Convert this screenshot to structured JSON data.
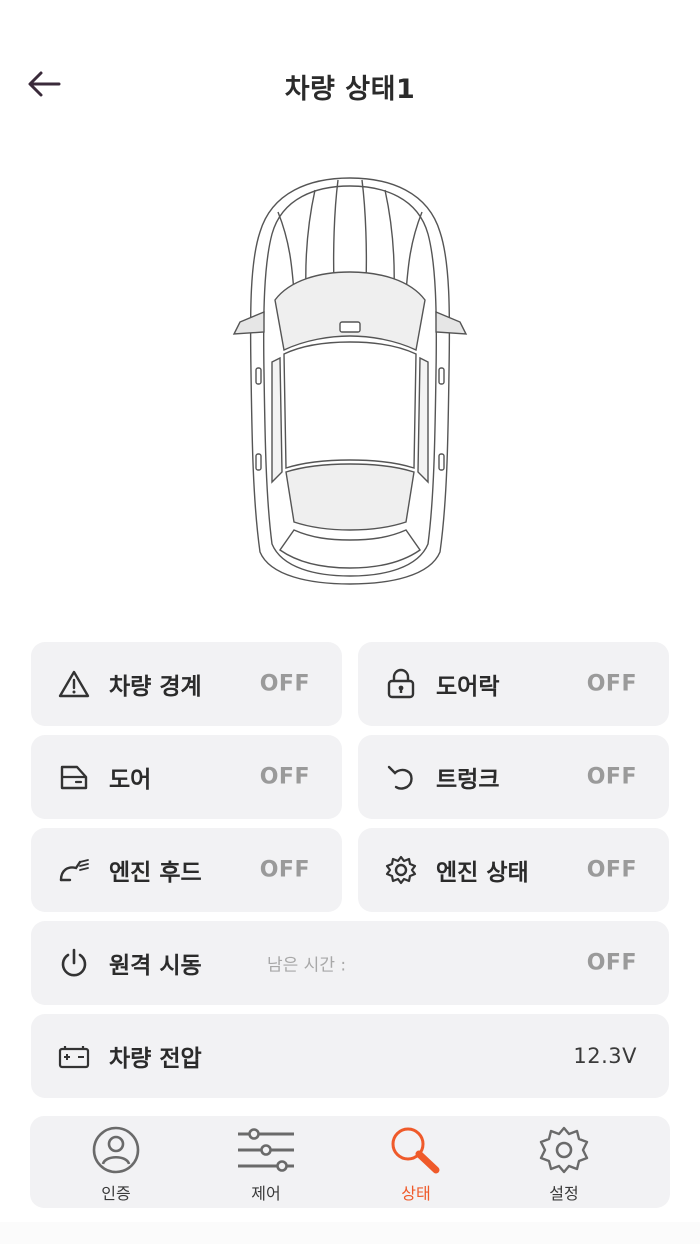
{
  "header": {
    "title": "차량 상태1"
  },
  "cards": {
    "alarm": {
      "label": "차량 경계",
      "value": "OFF",
      "icon": "warning-triangle-icon"
    },
    "doorlock": {
      "label": "도어락",
      "value": "OFF",
      "icon": "lock-icon"
    },
    "door": {
      "label": "도어",
      "value": "OFF",
      "icon": "car-door-icon"
    },
    "trunk": {
      "label": "트렁크",
      "value": "OFF",
      "icon": "trunk-icon"
    },
    "hood": {
      "label": "엔진 후드",
      "value": "OFF",
      "icon": "engine-hood-icon"
    },
    "engine": {
      "label": "엔진 상태",
      "value": "OFF",
      "icon": "gear-icon"
    },
    "remote_start": {
      "label": "원격 시동",
      "sublabel": "남은 시간 :",
      "value": "OFF",
      "icon": "power-icon"
    },
    "voltage": {
      "label": "차량 전압",
      "value": "12.3V",
      "icon": "battery-icon"
    }
  },
  "nav": {
    "items": [
      {
        "label": "인증",
        "icon": "user-icon",
        "active": false
      },
      {
        "label": "제어",
        "icon": "sliders-icon",
        "active": false
      },
      {
        "label": "상태",
        "icon": "search-icon",
        "active": true
      },
      {
        "label": "설정",
        "icon": "gear-icon",
        "active": false
      }
    ]
  },
  "colors": {
    "accent": "#ef5a2a",
    "card_bg": "#f2f2f4",
    "value_off": "#9a9a9a"
  }
}
